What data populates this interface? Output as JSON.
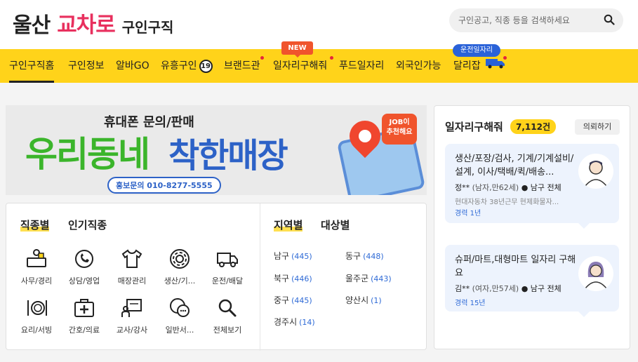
{
  "header": {
    "logo_part1": "울산",
    "logo_part2": "교차로",
    "logo_part3": "구인구직",
    "search_placeholder": "구인공고, 직종 등을 검색하세요"
  },
  "nav": {
    "items": [
      {
        "label": "구인구직홈"
      },
      {
        "label": "구인정보"
      },
      {
        "label": "알바GO"
      },
      {
        "label": "유흥구인",
        "badge": "19"
      },
      {
        "label": "브랜드관"
      },
      {
        "label": "일자리구해줘"
      },
      {
        "label": "푸드일자리"
      },
      {
        "label": "외국인가능"
      },
      {
        "label": "달리잡"
      }
    ],
    "new_tag": "NEW",
    "drive_tag": "운전일자리",
    "accent": "#ffd31a"
  },
  "banner": {
    "top": "휴대폰 문의/판매",
    "big1": "우리동네",
    "big2": "착한매장",
    "contact": "홍보문의 010-8277-5555",
    "rec_line1": "JOB이",
    "rec_line2": "추천해요"
  },
  "categories": {
    "tabs": [
      "직종별",
      "인기직종",
      "지역별",
      "대상별"
    ],
    "jobs": [
      {
        "label": "사무/경리",
        "icon": "desk-worker-icon"
      },
      {
        "label": "상담/영업",
        "icon": "phone-chat-icon"
      },
      {
        "label": "매장관리",
        "icon": "shirt-icon"
      },
      {
        "label": "생산/기...",
        "icon": "gear-icon"
      },
      {
        "label": "운전/배달",
        "icon": "truck-icon"
      },
      {
        "label": "요리/서빙",
        "icon": "dish-icon"
      },
      {
        "label": "간호/의료",
        "icon": "medical-kit-icon"
      },
      {
        "label": "교사/강사",
        "icon": "teacher-board-icon"
      },
      {
        "label": "일반서...",
        "icon": "speech-bubble-icon"
      },
      {
        "label": "전체보기",
        "icon": "search-icon"
      }
    ],
    "regions": [
      {
        "name": "남구",
        "count": "(445)"
      },
      {
        "name": "동구",
        "count": "(448)"
      },
      {
        "name": "북구",
        "count": "(446)"
      },
      {
        "name": "울주군",
        "count": "(443)"
      },
      {
        "name": "중구",
        "count": "(445)"
      },
      {
        "name": "양산시",
        "count": "(1)"
      },
      {
        "name": "경주시",
        "count": "(14)"
      }
    ]
  },
  "side": {
    "title": "일자리구해줘",
    "count": "7,112건",
    "request": "의뢰하기",
    "jobs": [
      {
        "title": "생산/포장/검사, 기계/기계설비/설계, 이사/택배/퀵/배송...",
        "name": "정**",
        "info": "(남자,만62세)",
        "location": "남구 전체",
        "desc": "현대자동차 38년근무 현제화물자...",
        "exp": "경력 1년"
      },
      {
        "title": "슈퍼/마트,대형마트 일자리 구해요",
        "name": "김**",
        "info": "(여자,만57세)",
        "location": "남구 전체",
        "desc": "",
        "exp": "경력 15년"
      }
    ]
  }
}
